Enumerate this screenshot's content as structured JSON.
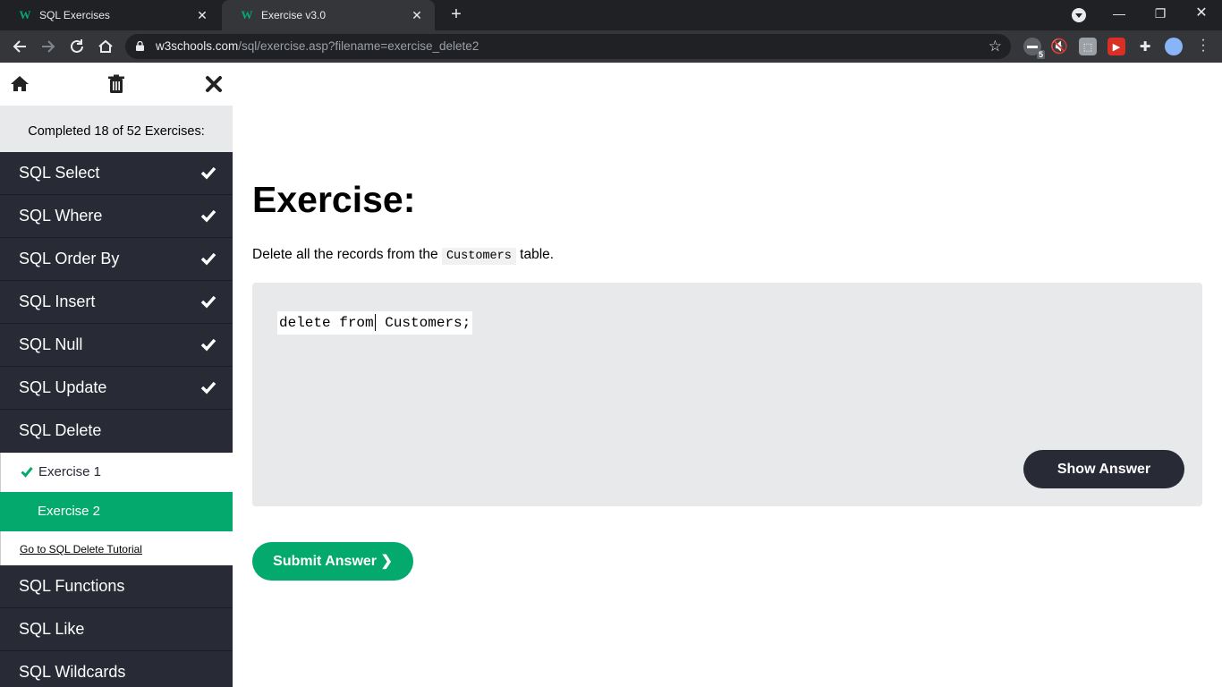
{
  "browser": {
    "tabs": [
      {
        "title": "SQL Exercises",
        "favicon": "w3schools-icon",
        "active": false
      },
      {
        "title": "Exercise v3.0",
        "favicon": "w3schools-icon",
        "active": true
      }
    ],
    "new_tab_symbol": "+",
    "url_host": "w3schools.com",
    "url_path": "/sql/exercise.asp?filename=exercise_delete2",
    "extension_badge": "5"
  },
  "sidebar": {
    "progress_text": "Completed 18 of 52 Exercises:",
    "items_before": [
      {
        "label": "SQL Select",
        "done": true
      },
      {
        "label": "SQL Where",
        "done": true
      },
      {
        "label": "SQL Order By",
        "done": true
      },
      {
        "label": "SQL Insert",
        "done": true
      },
      {
        "label": "SQL Null",
        "done": true
      },
      {
        "label": "SQL Update",
        "done": true
      },
      {
        "label": "SQL Delete",
        "done": false
      }
    ],
    "sub_items": [
      {
        "label": "Exercise 1",
        "done": true
      },
      {
        "label": "Exercise 2",
        "current": true
      }
    ],
    "tutorial_link": "Go to SQL Delete Tutorial",
    "items_after": [
      {
        "label": "SQL Functions"
      },
      {
        "label": "SQL Like"
      },
      {
        "label": "SQL Wildcards"
      }
    ]
  },
  "exercise": {
    "title": "Exercise:",
    "instruction_before": "Delete all the records from the",
    "instruction_code": "Customers",
    "instruction_after": "table.",
    "code_part1": "delete from",
    "code_part2": " Customers;",
    "show_answer_label": "Show Answer",
    "submit_label": "Submit Answer ❯"
  },
  "colors": {
    "sidebar_bg": "#282a35",
    "accent_green": "#04aa6d",
    "code_bg": "#e7e9eb"
  }
}
